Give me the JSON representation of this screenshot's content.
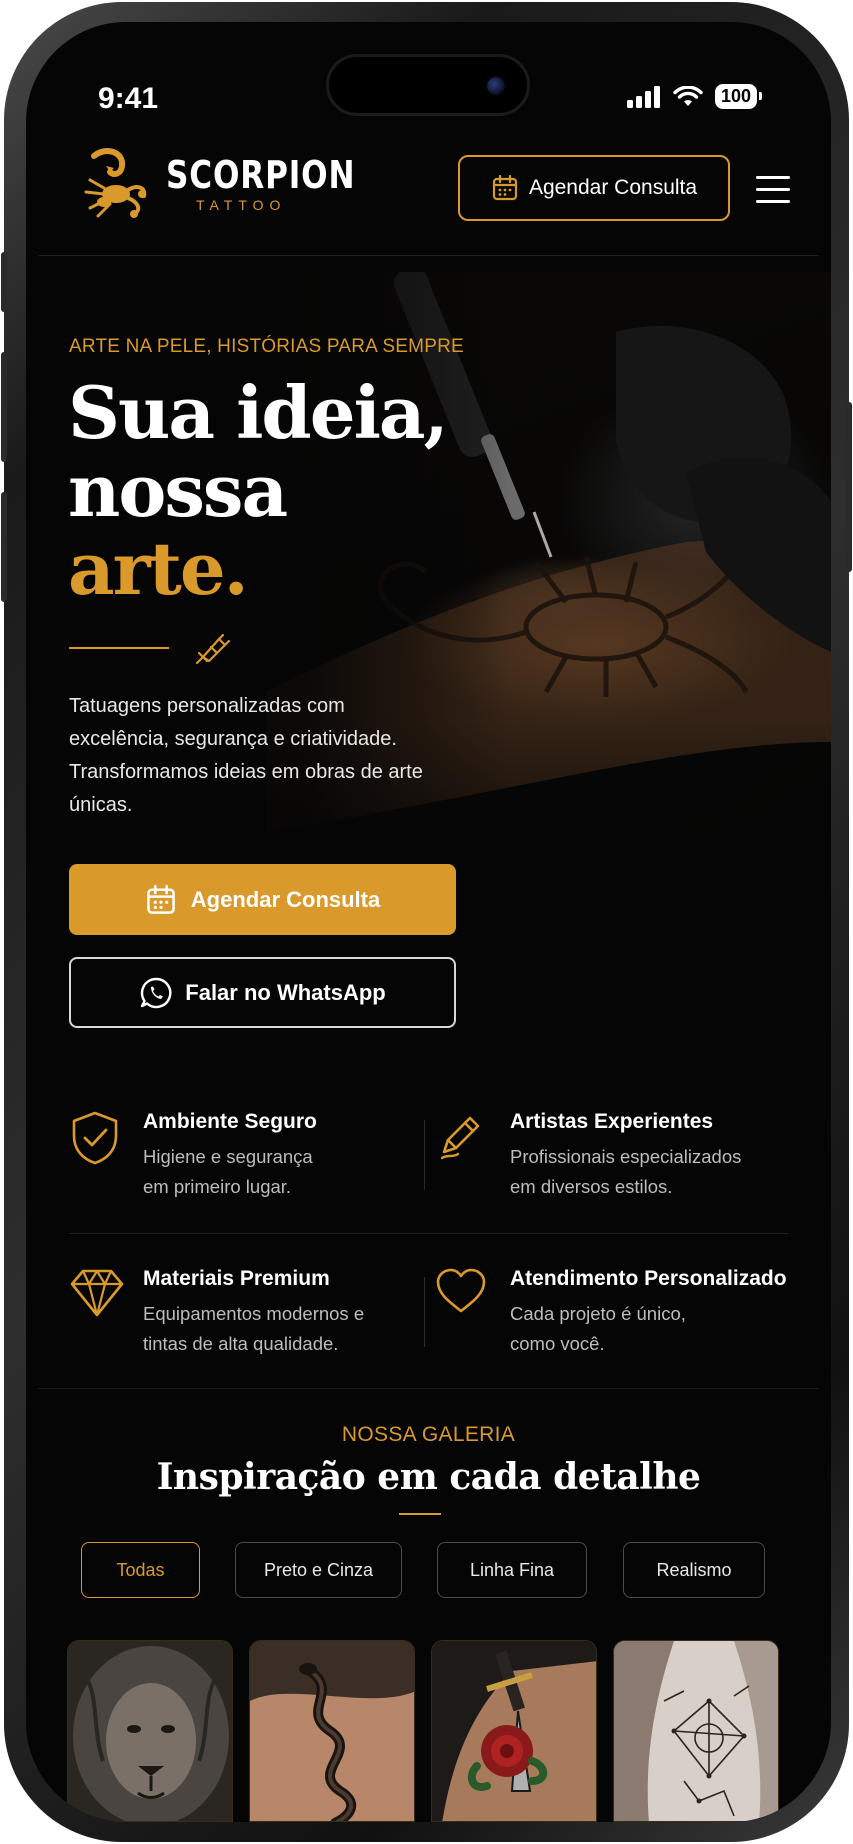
{
  "status_bar": {
    "time": "9:41",
    "battery": "100"
  },
  "header": {
    "brand_name": "SCORPION",
    "brand_sub": "TATTOO",
    "cta_label": "Agendar Consulta"
  },
  "hero": {
    "eyebrow": "ARTE NA PELE, HISTÓRIAS PARA SEMPRE",
    "title_line1": "Sua ideia,",
    "title_line2": "nossa",
    "title_line3": "arte.",
    "description": "Tatuagens personalizadas com excelência, segurança e criatividade. Transformamos ideias em obras de arte únicas.",
    "primary_cta": "Agendar Consulta",
    "secondary_cta": "Falar no WhatsApp"
  },
  "features": [
    {
      "title": "Ambiente Seguro",
      "desc_line1": "Higiene e segurança",
      "desc_line2": "em primeiro lugar.",
      "icon": "shield-check-icon"
    },
    {
      "title": "Artistas Experientes",
      "desc_line1": "Profissionais especializados",
      "desc_line2": "em diversos estilos.",
      "icon": "pen-icon"
    },
    {
      "title": "Materiais Premium",
      "desc_line1": "Equipamentos modernos e",
      "desc_line2": "tintas de alta qualidade.",
      "icon": "diamond-icon"
    },
    {
      "title": "Atendimento Personalizado",
      "desc_line1": "Cada projeto é único,",
      "desc_line2": "como você.",
      "icon": "heart-icon"
    }
  ],
  "gallery": {
    "eyebrow": "NOSSA GALERIA",
    "title": "Inspiração em cada detalhe",
    "filters": [
      "Todas",
      "Preto e Cinza",
      "Linha Fina",
      "Realismo"
    ],
    "active_filter": "Todas",
    "thumbnails": [
      "lion-tattoo-image",
      "snake-tattoo-image",
      "dagger-rose-tattoo-image",
      "geometric-tattoo-image"
    ]
  },
  "colors": {
    "accent": "#d99a2b",
    "background": "#050505",
    "text": "#ffffff",
    "muted": "#bdbdbd"
  }
}
